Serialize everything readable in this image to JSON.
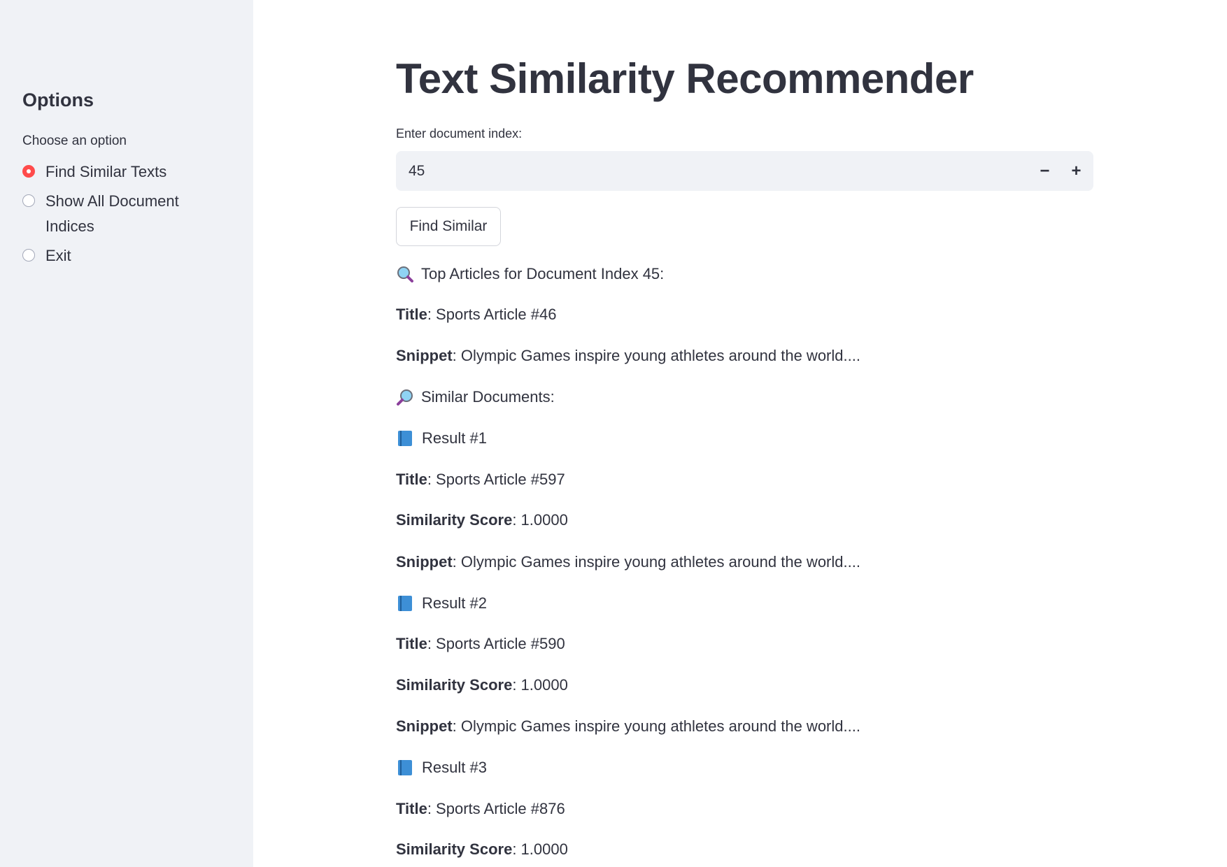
{
  "sidebar": {
    "title": "Options",
    "radio_label": "Choose an option",
    "options": [
      {
        "label": "Find Similar Texts",
        "checked": true
      },
      {
        "label": "Show All Document Indices",
        "checked": false
      },
      {
        "label": "Exit",
        "checked": false
      }
    ]
  },
  "main": {
    "title": "Text Similarity Recommender",
    "input_label": "Enter document index:",
    "input_value": "45",
    "minus_label": "−",
    "plus_label": "+",
    "button_label": "Find Similar",
    "top_articles_heading": "Top Articles for Document Index 45:",
    "query": {
      "title_key": "Title",
      "title_value": ": Sports Article #46",
      "snippet_key": "Snippet",
      "snippet_value": ": Olympic Games inspire young athletes around the world...."
    },
    "similar_heading": "Similar Documents:",
    "results": [
      {
        "heading": "Result #1",
        "title_key": "Title",
        "title_value": ": Sports Article #597",
        "score_key": "Similarity Score",
        "score_value": ": 1.0000",
        "snippet_key": "Snippet",
        "snippet_value": ": Olympic Games inspire young athletes around the world...."
      },
      {
        "heading": "Result #2",
        "title_key": "Title",
        "title_value": ": Sports Article #590",
        "score_key": "Similarity Score",
        "score_value": ": 1.0000",
        "snippet_key": "Snippet",
        "snippet_value": ": Olympic Games inspire young athletes around the world...."
      },
      {
        "heading": "Result #3",
        "title_key": "Title",
        "title_value": ": Sports Article #876",
        "score_key": "Similarity Score",
        "score_value": ": 1.0000"
      }
    ]
  },
  "colors": {
    "accent": "#ff4b4b",
    "sidebar_bg": "#f0f2f6",
    "text": "#31333f",
    "book_icon": "#3d8fd6"
  },
  "icons": {
    "top_articles": "magnifier-left-icon",
    "similar": "magnifier-right-icon",
    "result": "blue-book-icon"
  }
}
